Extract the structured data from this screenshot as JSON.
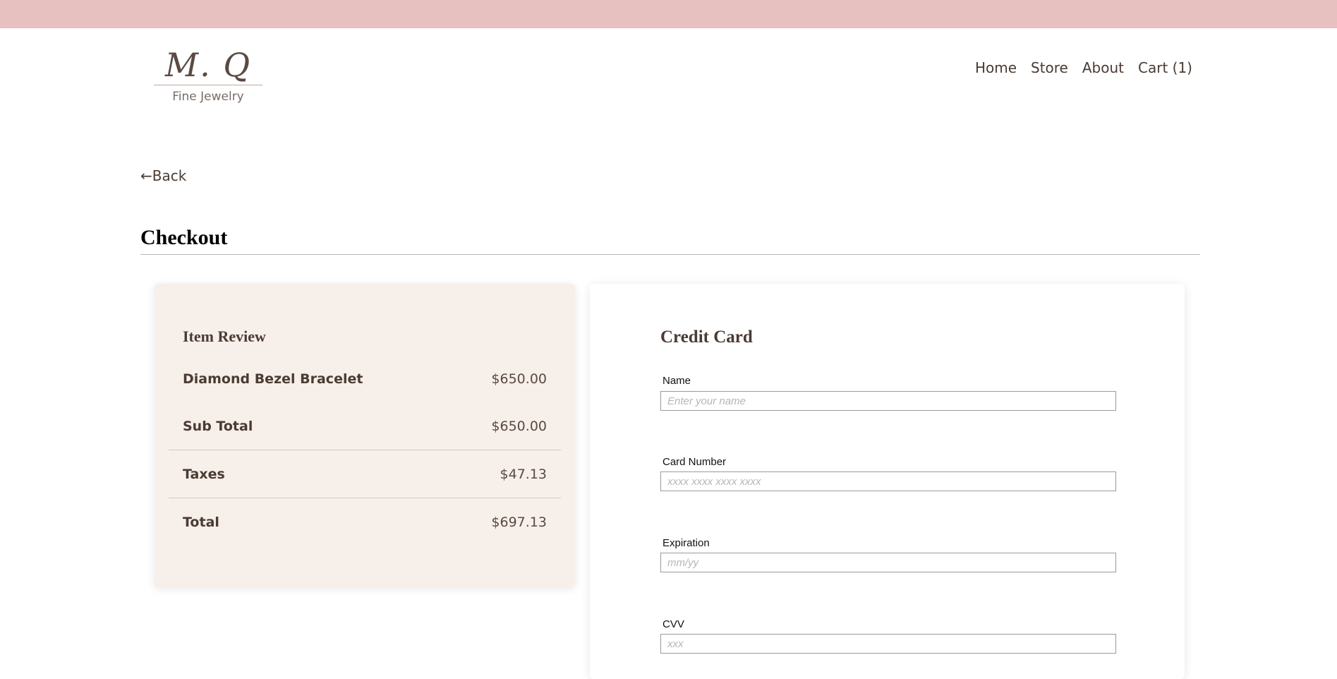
{
  "brand": {
    "logo_mark": "M. Q",
    "logo_sub": "Fine Jewelry"
  },
  "nav": {
    "home": "Home",
    "store": "Store",
    "about": "About",
    "cart": "Cart (1)"
  },
  "back_label": "←Back",
  "page_title": "Checkout",
  "review": {
    "title": "Item Review",
    "item_name": "Diamond Bezel Bracelet",
    "item_price": "$650.00",
    "subtotal_label": "Sub Total",
    "subtotal_value": "$650.00",
    "taxes_label": "Taxes",
    "taxes_value": "$47.13",
    "total_label": "Total",
    "total_value": "$697.13"
  },
  "credit_card": {
    "title": "Credit Card",
    "name_label": "Name",
    "name_placeholder": "Enter your name",
    "number_label": "Card Number",
    "number_placeholder": "xxxx xxxx xxxx xxxx",
    "expiration_label": "Expiration",
    "expiration_placeholder": "mm/yy",
    "cvv_label": "CVV",
    "cvv_placeholder": "xxx"
  },
  "colors": {
    "top_bar": "#e6c1c0",
    "review_bg": "#f7efea",
    "text": "#4a3b33"
  }
}
